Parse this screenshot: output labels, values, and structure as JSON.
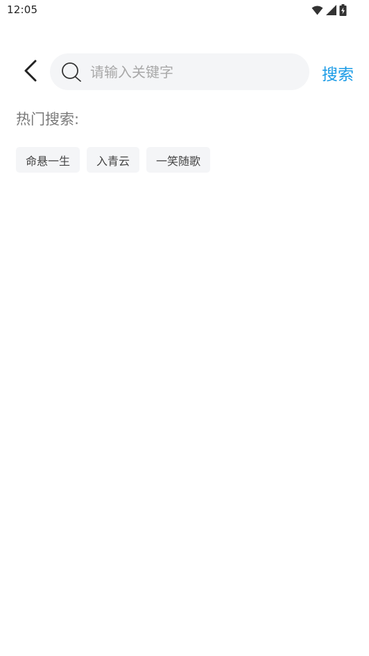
{
  "status_bar": {
    "time": "12:05",
    "icons": [
      "wifi-icon",
      "signal-icon",
      "battery-charging-icon"
    ]
  },
  "search": {
    "placeholder": "请输入关键字",
    "value": "",
    "button_label": "搜索"
  },
  "hot_search": {
    "title": "热门搜索:",
    "tags": [
      "命悬一生",
      "入青云",
      "一笑随歌"
    ]
  },
  "colors": {
    "accent": "#1a9be6",
    "search_bg": "#f4f5f7",
    "tag_bg": "#f4f5f7",
    "title_gray": "#7a7a7a"
  }
}
